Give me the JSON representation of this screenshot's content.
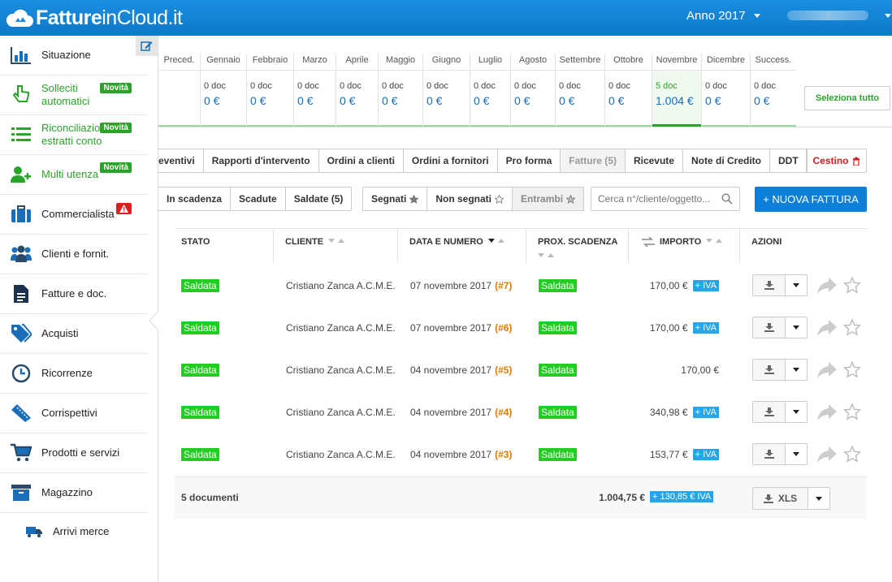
{
  "header": {
    "logo_bold": "Fatture",
    "logo_rest": "inCloud.it",
    "year": "Anno 2017"
  },
  "sidebar": {
    "items": [
      {
        "label": "Situazione",
        "icon": "bar-chart-icon"
      },
      {
        "label": "Solleciti\nautomatici",
        "icon": "pointing-hand-icon",
        "badge": "Novità"
      },
      {
        "label": "Riconciliazione\nestratti conto",
        "icon": "list-icon",
        "badge": "Novità"
      },
      {
        "label": "Multi utenza",
        "icon": "add-user-icon",
        "badge": "Novità"
      },
      {
        "label": "Commercialista",
        "icon": "briefcase-icon"
      },
      {
        "label": "Clienti e fornit.",
        "icon": "users-icon"
      },
      {
        "label": "Fatture e doc.",
        "icon": "document-icon"
      },
      {
        "label": "Acquisti",
        "icon": "tags-icon"
      },
      {
        "label": "Ricorrenze",
        "icon": "clock-icon"
      },
      {
        "label": "Corrispettivi",
        "icon": "ticket-icon"
      },
      {
        "label": "Prodotti e servizi",
        "icon": "cart-icon"
      },
      {
        "label": "Magazzino",
        "icon": "archive-icon"
      },
      {
        "label": "Arrivi merce",
        "icon": "truck-icon"
      }
    ]
  },
  "months": [
    {
      "name": "Preced.",
      "docs": "",
      "value": ""
    },
    {
      "name": "Gennaio",
      "docs": "0 doc",
      "value": "0 €"
    },
    {
      "name": "Febbraio",
      "docs": "0 doc",
      "value": "0 €"
    },
    {
      "name": "Marzo",
      "docs": "0 doc",
      "value": "0 €"
    },
    {
      "name": "Aprile",
      "docs": "0 doc",
      "value": "0 €"
    },
    {
      "name": "Maggio",
      "docs": "0 doc",
      "value": "0 €"
    },
    {
      "name": "Giugno",
      "docs": "0 doc",
      "value": "0 €"
    },
    {
      "name": "Luglio",
      "docs": "0 doc",
      "value": "0 €"
    },
    {
      "name": "Agosto",
      "docs": "0 doc",
      "value": "0 €"
    },
    {
      "name": "Settembre",
      "docs": "0 doc",
      "value": "0 €"
    },
    {
      "name": "Ottobre",
      "docs": "0 doc",
      "value": "0 €"
    },
    {
      "name": "Novembre",
      "docs": "5 doc",
      "value": "1.004 €",
      "selected": true
    },
    {
      "name": "Dicembre",
      "docs": "0 doc",
      "value": "0 €"
    },
    {
      "name": "Success.",
      "docs": "0 doc",
      "value": "0 €"
    }
  ],
  "select_all_label": "Seleziona tutto",
  "doc_tabs": [
    "eventivi",
    "Rapporti d'intervento",
    "Ordini a clienti",
    "Ordini a fornitori",
    "Pro forma",
    "Fatture (5)",
    "Ricevute",
    "Note di Credito",
    "DDT"
  ],
  "active_doc_tab": "Fatture (5)",
  "cestino_label": "Cestino",
  "status_filters": [
    "In scadenza",
    "Scadute",
    "Saldate (5)"
  ],
  "mark_filters": [
    "Segnati",
    "Non segnati",
    "Entrambi"
  ],
  "active_mark_filter": "Entrambi",
  "search": {
    "placeholder": "Cerca n°/cliente/oggetto..."
  },
  "new_invoice_label": "+ NUOVA FATTURA",
  "table": {
    "columns": [
      "STATO",
      "CLIENTE",
      "DATA E NUMERO",
      "PROX. SCADENZA",
      "IMPORTO",
      "AZIONI"
    ],
    "rows": [
      {
        "stato": "Saldata",
        "cliente": "Cristiano Zanca A.C.M.E.",
        "data": "07 novembre 2017",
        "numero": "(#7)",
        "scadenza": "Saldata",
        "importo": "170,00 €",
        "iva": "+ IVA"
      },
      {
        "stato": "Saldata",
        "cliente": "Cristiano Zanca A.C.M.E.",
        "data": "07 novembre 2017",
        "numero": "(#6)",
        "scadenza": "Saldata",
        "importo": "170,00 €",
        "iva": "+ IVA"
      },
      {
        "stato": "Saldata",
        "cliente": "Cristiano Zanca A.C.M.E.",
        "data": "04 novembre 2017",
        "numero": "(#5)",
        "scadenza": "Saldata",
        "importo": "170,00 €",
        "iva": ""
      },
      {
        "stato": "Saldata",
        "cliente": "Cristiano Zanca A.C.M.E.",
        "data": "04 novembre 2017",
        "numero": "(#4)",
        "scadenza": "Saldata",
        "importo": "340,98 €",
        "iva": "+ IVA"
      },
      {
        "stato": "Saldata",
        "cliente": "Cristiano Zanca A.C.M.E.",
        "data": "04 novembre 2017",
        "numero": "(#3)",
        "scadenza": "Saldata",
        "importo": "153,77 €",
        "iva": "+ IVA"
      }
    ],
    "footer": {
      "count": "5 documenti",
      "total": "1.004,75 €",
      "iva": "+ 130,85 € IVA",
      "xls_label": "XLS"
    }
  },
  "colors": {
    "brand": "#0e7fd6",
    "green": "#2aa32a",
    "status_green": "#22cc22",
    "iva_blue": "#26a6e8",
    "number_orange": "#e07b00",
    "danger": "#d02020"
  }
}
